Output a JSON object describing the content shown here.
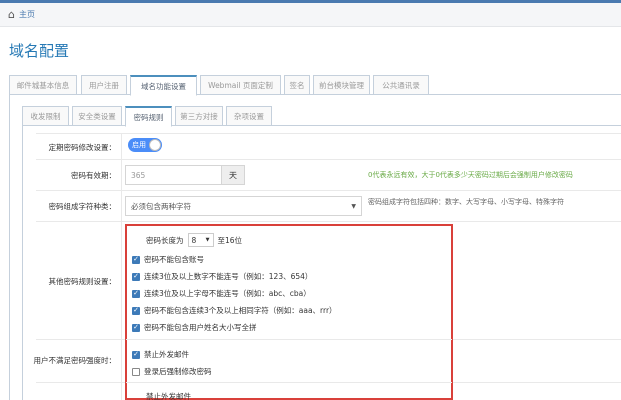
{
  "breadcrumb": {
    "home": "主页"
  },
  "page_title": "域名配置",
  "tabs_top": [
    {
      "label": "邮件城基本信息"
    },
    {
      "label": "用户注册"
    },
    {
      "label": "域名功能设置"
    },
    {
      "label": "Webmail 页面定制"
    },
    {
      "label": "签名"
    },
    {
      "label": "前台模块管理"
    },
    {
      "label": "公共通讯录"
    }
  ],
  "tabs_sub": [
    {
      "label": "收发限制"
    },
    {
      "label": "安全类设置"
    },
    {
      "label": "密码规则"
    },
    {
      "label": "第三方对接"
    },
    {
      "label": "杂项设置"
    }
  ],
  "form": {
    "periodic_change": {
      "label": "定期密码修改设置：",
      "toggle": "启用"
    },
    "validity": {
      "label": "密码有效期：",
      "value": "365",
      "unit": "天",
      "hint": "0代表永远有效，大于0代表多少天密码过期后会强制用户修改密码"
    },
    "charset": {
      "label": "密码组成字符种类：",
      "value": "必须包含两种字符",
      "hint": "密码组成字符包括四种：数字、大写字母、小写字母、特殊字符"
    },
    "other_rules": {
      "label": "其他密码规则设置：",
      "length_prefix": "密码长度为",
      "length_value": "8",
      "length_suffix": "至16位",
      "rules": [
        {
          "text": "密码不能包含账号",
          "checked": true
        },
        {
          "text": "连续3位及以上数字不能连号（例如：123、654）",
          "checked": true
        },
        {
          "text": "连续3位及以上字母不能连号（例如：abc、cba）",
          "checked": true
        },
        {
          "text": "密码不能包含连续3个及以上相同字符（例如：aaa、rrr）",
          "checked": true
        },
        {
          "text": "密码不能包含用户姓名大小写全拼",
          "checked": true
        }
      ]
    },
    "weak": {
      "label": "用户不满足密码强度时：",
      "options": [
        {
          "text": "禁止外发邮件",
          "checked": true
        },
        {
          "text": "登录后强制修改密码",
          "checked": false
        }
      ],
      "partial": "禁止外发邮件"
    }
  },
  "colors": {
    "accent": "#4b8df8",
    "highlight_box": "#d9403a",
    "hint_green": "#69aa46"
  }
}
